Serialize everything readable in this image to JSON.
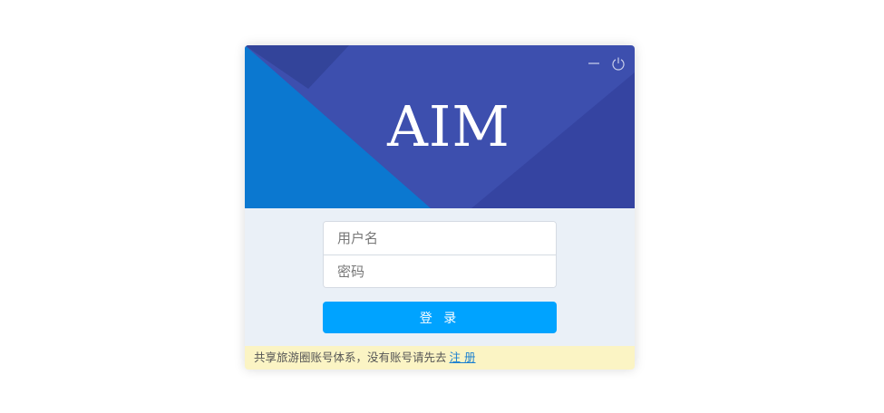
{
  "window": {
    "controls": {
      "minimize_icon": "minimize-icon",
      "power_icon": "power-icon"
    }
  },
  "banner": {
    "logo_text": "AIM",
    "colors": {
      "primary": "#3d4fae",
      "dark": "#3544a1",
      "blue": "#0b78d0"
    }
  },
  "login_form": {
    "username_placeholder": "用户名",
    "password_placeholder": "密码",
    "username_value": "",
    "password_value": "",
    "submit_label": "登 录",
    "submit_color": "#00a3ff"
  },
  "footer": {
    "notice_text": "共享旅游圈账号体系，没有账号请先去",
    "register_link": "注 册"
  }
}
